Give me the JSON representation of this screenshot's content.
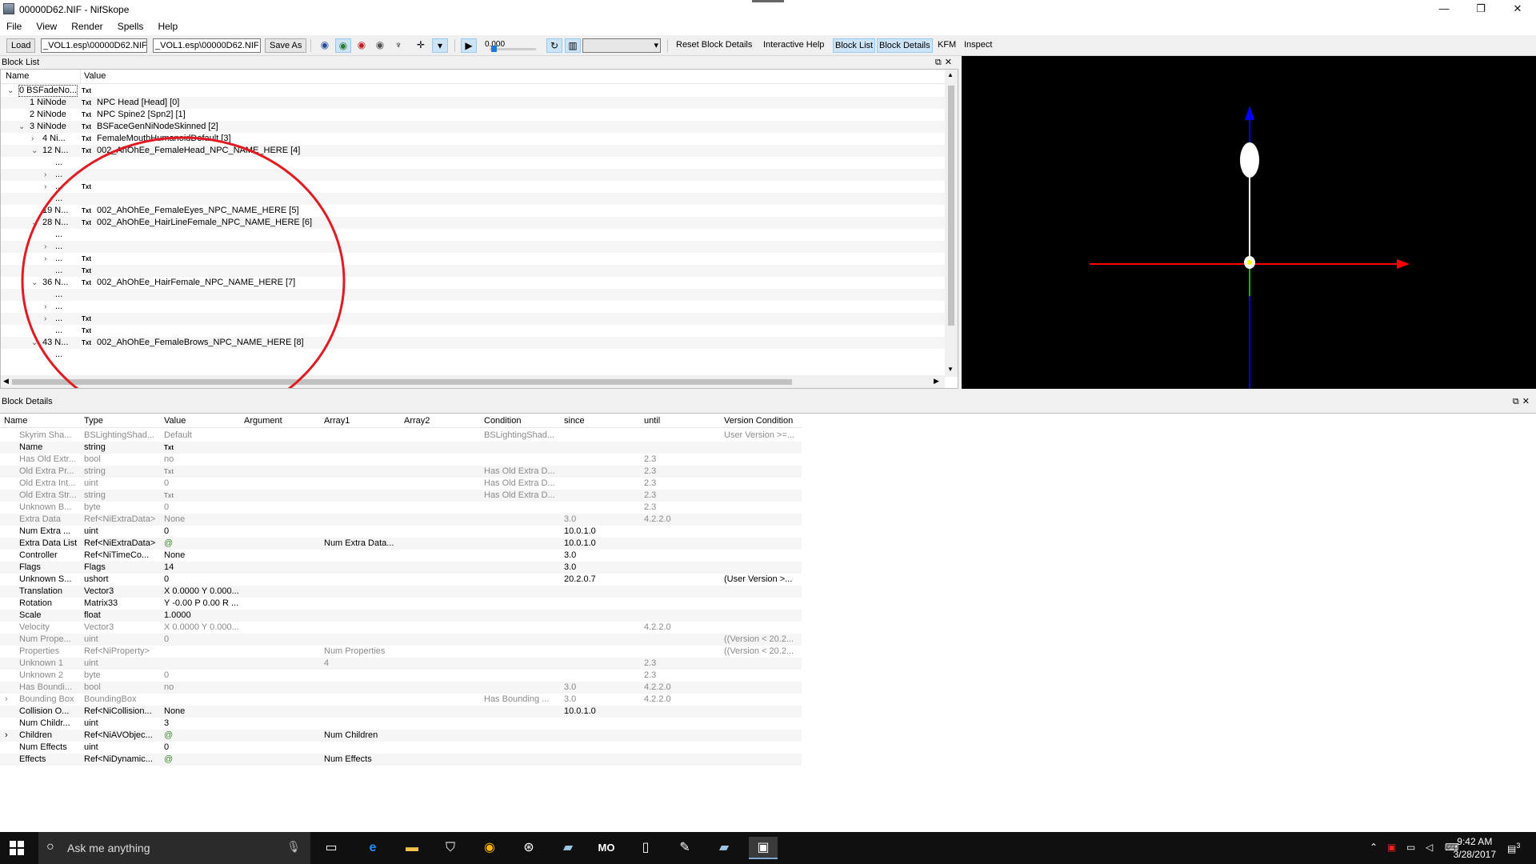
{
  "window": {
    "title": "00000D62.NIF - NifSkope",
    "minimize": "—",
    "maximize": "❐",
    "close": "✕"
  },
  "menu": [
    "File",
    "View",
    "Render",
    "Spells",
    "Help"
  ],
  "toolbar": {
    "load": "Load",
    "path1": "_VOL1.esp\\00000D62.NIF",
    "path2": "_VOL1.esp\\00000D62.NIF",
    "save_as": "Save As",
    "time": "0.000",
    "reset_block_details": "Reset Block Details",
    "interactive_help": "Interactive Help",
    "block_list": "Block List",
    "block_details": "Block Details",
    "kfm": "KFM",
    "inspect": "Inspect"
  },
  "block_list": {
    "title": "Block List",
    "columns": [
      "Name",
      "Value"
    ],
    "rows": [
      {
        "indent": 0,
        "chev": "v",
        "name": "0 BSFadeNo...",
        "txt": true,
        "value": ""
      },
      {
        "indent": 1,
        "chev": "",
        "name": "1 NiNode",
        "txt": true,
        "value": "NPC Head [Head] [0]"
      },
      {
        "indent": 1,
        "chev": "",
        "name": "2 NiNode",
        "txt": true,
        "value": "NPC Spine2 [Spn2] [1]"
      },
      {
        "indent": 1,
        "chev": "v",
        "name": "3 NiNode",
        "txt": true,
        "value": "BSFaceGenNiNodeSkinned [2]"
      },
      {
        "indent": 2,
        "chev": ">",
        "name": "4 Ni...",
        "txt": true,
        "value": "FemaleMouthHumanoidDefault [3]"
      },
      {
        "indent": 2,
        "chev": "v",
        "name": "12 N...",
        "txt": true,
        "value": "002_AhOhEe_FemaleHead_NPC_NAME_HERE [4]"
      },
      {
        "indent": 3,
        "chev": "",
        "name": "...",
        "txt": false,
        "value": ""
      },
      {
        "indent": 3,
        "chev": ">",
        "name": "...",
        "txt": false,
        "value": ""
      },
      {
        "indent": 3,
        "chev": ">",
        "name": "...",
        "txt": true,
        "value": ""
      },
      {
        "indent": 3,
        "chev": "",
        "name": "...",
        "txt": false,
        "value": ""
      },
      {
        "indent": 2,
        "chev": "",
        "name": "19 N...",
        "txt": true,
        "value": "002_AhOhEe_FemaleEyes_NPC_NAME_HERE [5]"
      },
      {
        "indent": 2,
        "chev": "v",
        "name": "28 N...",
        "txt": true,
        "value": "002_AhOhEe_HairLineFemale_NPC_NAME_HERE [6]"
      },
      {
        "indent": 3,
        "chev": "",
        "name": "...",
        "txt": false,
        "value": ""
      },
      {
        "indent": 3,
        "chev": ">",
        "name": "...",
        "txt": false,
        "value": ""
      },
      {
        "indent": 3,
        "chev": ">",
        "name": "...",
        "txt": true,
        "value": ""
      },
      {
        "indent": 3,
        "chev": "",
        "name": "...",
        "txt": true,
        "value": ""
      },
      {
        "indent": 2,
        "chev": "v",
        "name": "36 N...",
        "txt": true,
        "value": "002_AhOhEe_HairFemale_NPC_NAME_HERE [7]"
      },
      {
        "indent": 3,
        "chev": "",
        "name": "...",
        "txt": false,
        "value": ""
      },
      {
        "indent": 3,
        "chev": ">",
        "name": "...",
        "txt": false,
        "value": ""
      },
      {
        "indent": 3,
        "chev": ">",
        "name": "...",
        "txt": true,
        "value": ""
      },
      {
        "indent": 3,
        "chev": "",
        "name": "...",
        "txt": true,
        "value": ""
      },
      {
        "indent": 2,
        "chev": "v",
        "name": "43 N...",
        "txt": true,
        "value": "002_AhOhEe_FemaleBrows_NPC_NAME_HERE [8]"
      },
      {
        "indent": 3,
        "chev": "",
        "name": "...",
        "txt": false,
        "value": ""
      }
    ]
  },
  "block_details": {
    "title": "Block Details",
    "columns": [
      "Name",
      "Type",
      "Value",
      "Argument",
      "Array1",
      "Array2",
      "Condition",
      "since",
      "until",
      "Version Condition"
    ],
    "rows": [
      {
        "grey": true,
        "exp": "",
        "name": "Skyrim Sha...",
        "type": "BSLightingShad...",
        "value": "Default",
        "arg": "",
        "a1": "",
        "a2": "",
        "cond": "BSLightingShad...",
        "since": "",
        "until": "",
        "vc": "User Version >=..."
      },
      {
        "grey": false,
        "exp": "",
        "name": "Name",
        "type": "string",
        "value": "Txt",
        "arg": "",
        "a1": "",
        "a2": "",
        "cond": "",
        "since": "",
        "until": "",
        "vc": ""
      },
      {
        "grey": true,
        "exp": "",
        "name": "Has Old Extr...",
        "type": "bool",
        "value": "no",
        "arg": "",
        "a1": "",
        "a2": "",
        "cond": "",
        "since": "",
        "until": "2.3",
        "vc": ""
      },
      {
        "grey": true,
        "exp": "",
        "name": "Old Extra Pr...",
        "type": "string",
        "value": "Txt",
        "arg": "",
        "a1": "",
        "a2": "",
        "cond": "Has Old Extra D...",
        "since": "",
        "until": "2.3",
        "vc": ""
      },
      {
        "grey": true,
        "exp": "",
        "name": "Old Extra Int...",
        "type": "uint",
        "value": "0",
        "arg": "",
        "a1": "",
        "a2": "",
        "cond": "Has Old Extra D...",
        "since": "",
        "until": "2.3",
        "vc": ""
      },
      {
        "grey": true,
        "exp": "",
        "name": "Old Extra Str...",
        "type": "string",
        "value": "Txt",
        "arg": "",
        "a1": "",
        "a2": "",
        "cond": "Has Old Extra D...",
        "since": "",
        "until": "2.3",
        "vc": ""
      },
      {
        "grey": true,
        "exp": "",
        "name": "Unknown B...",
        "type": "byte",
        "value": "0",
        "arg": "",
        "a1": "",
        "a2": "",
        "cond": "",
        "since": "",
        "until": "2.3",
        "vc": ""
      },
      {
        "grey": true,
        "exp": "",
        "name": "Extra Data",
        "type": "Ref<NiExtraData>",
        "value": "None",
        "arg": "",
        "a1": "",
        "a2": "",
        "cond": "",
        "since": "3.0",
        "until": "4.2.2.0",
        "vc": ""
      },
      {
        "grey": false,
        "exp": "",
        "name": "Num Extra ...",
        "type": "uint",
        "value": "0",
        "arg": "",
        "a1": "",
        "a2": "",
        "cond": "",
        "since": "10.0.1.0",
        "until": "",
        "vc": ""
      },
      {
        "grey": false,
        "exp": "",
        "name": "Extra Data List",
        "type": "Ref<NiExtraData>",
        "value": "@",
        "arg": "",
        "a1": "Num Extra Data...",
        "a2": "",
        "cond": "",
        "since": "10.0.1.0",
        "until": "",
        "vc": ""
      },
      {
        "grey": false,
        "exp": "",
        "name": "Controller",
        "type": "Ref<NiTimeCo...",
        "value": "None",
        "arg": "",
        "a1": "",
        "a2": "",
        "cond": "",
        "since": "3.0",
        "until": "",
        "vc": ""
      },
      {
        "grey": false,
        "exp": "",
        "name": "Flags",
        "type": "Flags",
        "value": "14",
        "arg": "",
        "a1": "",
        "a2": "",
        "cond": "",
        "since": "3.0",
        "until": "",
        "vc": ""
      },
      {
        "grey": false,
        "exp": "",
        "name": "Unknown S...",
        "type": "ushort",
        "value": "0",
        "arg": "",
        "a1": "",
        "a2": "",
        "cond": "",
        "since": "20.2.0.7",
        "until": "",
        "vc": "(User Version >..."
      },
      {
        "grey": false,
        "exp": "",
        "name": "Translation",
        "type": "Vector3",
        "value": "X 0.0000 Y 0.000...",
        "arg": "",
        "a1": "",
        "a2": "",
        "cond": "",
        "since": "",
        "until": "",
        "vc": ""
      },
      {
        "grey": false,
        "exp": "",
        "name": "Rotation",
        "type": "Matrix33",
        "value": "Y -0.00 P 0.00 R ...",
        "arg": "",
        "a1": "",
        "a2": "",
        "cond": "",
        "since": "",
        "until": "",
        "vc": ""
      },
      {
        "grey": false,
        "exp": "",
        "name": "Scale",
        "type": "float",
        "value": "1.0000",
        "arg": "",
        "a1": "",
        "a2": "",
        "cond": "",
        "since": "",
        "until": "",
        "vc": ""
      },
      {
        "grey": true,
        "exp": "",
        "name": "Velocity",
        "type": "Vector3",
        "value": "X 0.0000 Y 0.000...",
        "arg": "",
        "a1": "",
        "a2": "",
        "cond": "",
        "since": "",
        "until": "4.2.2.0",
        "vc": ""
      },
      {
        "grey": true,
        "exp": "",
        "name": "Num Prope...",
        "type": "uint",
        "value": "0",
        "arg": "",
        "a1": "",
        "a2": "",
        "cond": "",
        "since": "",
        "until": "",
        "vc": "((Version < 20.2..."
      },
      {
        "grey": true,
        "exp": "",
        "name": "Properties",
        "type": "Ref<NiProperty>",
        "value": "",
        "arg": "",
        "a1": "Num Properties",
        "a2": "",
        "cond": "",
        "since": "",
        "until": "",
        "vc": "((Version < 20.2..."
      },
      {
        "grey": true,
        "exp": "",
        "name": "Unknown 1",
        "type": "uint",
        "value": "",
        "arg": "",
        "a1": "4",
        "a2": "",
        "cond": "",
        "since": "",
        "until": "2.3",
        "vc": ""
      },
      {
        "grey": true,
        "exp": "",
        "name": "Unknown 2",
        "type": "byte",
        "value": "0",
        "arg": "",
        "a1": "",
        "a2": "",
        "cond": "",
        "since": "",
        "until": "2.3",
        "vc": ""
      },
      {
        "grey": true,
        "exp": "",
        "name": "Has Boundi...",
        "type": "bool",
        "value": "no",
        "arg": "",
        "a1": "",
        "a2": "",
        "cond": "",
        "since": "3.0",
        "until": "4.2.2.0",
        "vc": ""
      },
      {
        "grey": true,
        "exp": ">",
        "name": "Bounding Box",
        "type": "BoundingBox",
        "value": "",
        "arg": "",
        "a1": "",
        "a2": "",
        "cond": "Has Bounding ...",
        "since": "3.0",
        "until": "4.2.2.0",
        "vc": ""
      },
      {
        "grey": false,
        "exp": "",
        "name": "Collision O...",
        "type": "Ref<NiCollision...",
        "value": "None",
        "arg": "",
        "a1": "",
        "a2": "",
        "cond": "",
        "since": "10.0.1.0",
        "until": "",
        "vc": ""
      },
      {
        "grey": false,
        "exp": "",
        "name": "Num Childr...",
        "type": "uint",
        "value": "3",
        "arg": "",
        "a1": "",
        "a2": "",
        "cond": "",
        "since": "",
        "until": "",
        "vc": ""
      },
      {
        "grey": false,
        "exp": ">",
        "name": "Children",
        "type": "Ref<NiAVObjec...",
        "value": "@",
        "arg": "",
        "a1": "Num Children",
        "a2": "",
        "cond": "",
        "since": "",
        "until": "",
        "vc": ""
      },
      {
        "grey": false,
        "exp": "",
        "name": "Num Effects",
        "type": "uint",
        "value": "0",
        "arg": "",
        "a1": "",
        "a2": "",
        "cond": "",
        "since": "",
        "until": "",
        "vc": ""
      },
      {
        "grey": false,
        "exp": "",
        "name": "Effects",
        "type": "Ref<NiDynamic...",
        "value": "@",
        "arg": "",
        "a1": "Num Effects",
        "a2": "",
        "cond": "",
        "since": "",
        "until": "",
        "vc": ""
      }
    ]
  },
  "taskbar": {
    "search_placeholder": "Ask me anything",
    "time": "9:42 AM",
    "date": "3/28/2017",
    "notifications": "3"
  },
  "colors": {
    "annotation_circle": "#e21b22",
    "axis_x": "#ff0000",
    "axis_y": "#0000ff",
    "axis_z": "#00c000"
  }
}
